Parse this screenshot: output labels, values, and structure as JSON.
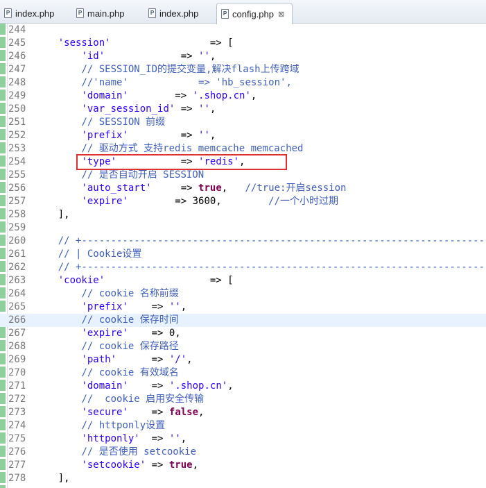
{
  "tabs": [
    {
      "label": "index.php",
      "active": false,
      "icon": "php-file-icon"
    },
    {
      "label": "main.php",
      "active": false,
      "icon": "php-file-icon"
    },
    {
      "label": "index.php",
      "active": false,
      "icon": "php-file-icon"
    },
    {
      "label": "config.php",
      "active": true,
      "icon": "php-file-icon",
      "close": "⊠"
    }
  ],
  "current_line": 266,
  "highlighted_line": 254,
  "colors": {
    "string": "#2a00ff",
    "keyword": "#7f0055",
    "comment": "#3f5fbf",
    "highlight_box": "#e03030"
  },
  "lines": [
    {
      "n": "244",
      "indent": "",
      "parts": []
    },
    {
      "n": "245",
      "indent": "    ",
      "parts": [
        [
          "str",
          "'session'"
        ],
        [
          "op",
          "                 => ["
        ]
      ]
    },
    {
      "n": "246",
      "indent": "        ",
      "parts": [
        [
          "str",
          "'id'"
        ],
        [
          "op",
          "             => "
        ],
        [
          "str",
          "''"
        ],
        [
          "op",
          ","
        ]
      ]
    },
    {
      "n": "247",
      "indent": "        ",
      "parts": [
        [
          "com",
          "// SESSION_ID的提交变量,解决flash上传跨域"
        ]
      ]
    },
    {
      "n": "248",
      "indent": "        ",
      "parts": [
        [
          "com",
          "//'name'            => 'hb_session',"
        ]
      ]
    },
    {
      "n": "249",
      "indent": "        ",
      "parts": [
        [
          "str",
          "'domain'"
        ],
        [
          "op",
          "        => "
        ],
        [
          "str",
          "'.shop.cn'"
        ],
        [
          "op",
          ","
        ]
      ]
    },
    {
      "n": "250",
      "indent": "        ",
      "parts": [
        [
          "str",
          "'var_session_id'"
        ],
        [
          "op",
          " => "
        ],
        [
          "str",
          "''"
        ],
        [
          "op",
          ","
        ]
      ]
    },
    {
      "n": "251",
      "indent": "        ",
      "parts": [
        [
          "com",
          "// SESSION 前缀"
        ]
      ]
    },
    {
      "n": "252",
      "indent": "        ",
      "parts": [
        [
          "str",
          "'prefix'"
        ],
        [
          "op",
          "         => "
        ],
        [
          "str",
          "''"
        ],
        [
          "op",
          ","
        ]
      ]
    },
    {
      "n": "253",
      "indent": "        ",
      "parts": [
        [
          "com",
          "// 驱动方式 支持redis memcache memcached"
        ]
      ]
    },
    {
      "n": "254",
      "indent": "        ",
      "parts": [
        [
          "str",
          "'type'"
        ],
        [
          "op",
          "           => "
        ],
        [
          "str",
          "'redis'"
        ],
        [
          "op",
          ","
        ]
      ]
    },
    {
      "n": "255",
      "indent": "        ",
      "parts": [
        [
          "com",
          "// 是否自动开启 SESSION"
        ]
      ]
    },
    {
      "n": "256",
      "indent": "        ",
      "parts": [
        [
          "str",
          "'auto_start'"
        ],
        [
          "op",
          "     => "
        ],
        [
          "kw",
          "true"
        ],
        [
          "op",
          ",   "
        ],
        [
          "com",
          "//true:开启session"
        ]
      ]
    },
    {
      "n": "257",
      "indent": "        ",
      "parts": [
        [
          "str",
          "'expire'"
        ],
        [
          "op",
          "        => 3600,        "
        ],
        [
          "com",
          "//一个小时过期"
        ]
      ]
    },
    {
      "n": "258",
      "indent": "    ",
      "parts": [
        [
          "op",
          "],"
        ]
      ]
    },
    {
      "n": "259",
      "indent": "",
      "parts": []
    },
    {
      "n": "260",
      "indent": "    ",
      "parts": [
        [
          "com",
          "// +----------------------------------------------------------------------"
        ]
      ]
    },
    {
      "n": "261",
      "indent": "    ",
      "parts": [
        [
          "com",
          "// | Cookie设置"
        ]
      ]
    },
    {
      "n": "262",
      "indent": "    ",
      "parts": [
        [
          "com",
          "// +----------------------------------------------------------------------"
        ]
      ]
    },
    {
      "n": "263",
      "indent": "    ",
      "parts": [
        [
          "str",
          "'cookie'"
        ],
        [
          "op",
          "                  => ["
        ]
      ]
    },
    {
      "n": "264",
      "indent": "        ",
      "parts": [
        [
          "com",
          "// cookie 名称前缀"
        ]
      ]
    },
    {
      "n": "265",
      "indent": "        ",
      "parts": [
        [
          "str",
          "'prefix'"
        ],
        [
          "op",
          "    => "
        ],
        [
          "str",
          "''"
        ],
        [
          "op",
          ","
        ]
      ]
    },
    {
      "n": "266",
      "indent": "        ",
      "parts": [
        [
          "com",
          "// cookie 保存时间"
        ]
      ]
    },
    {
      "n": "267",
      "indent": "        ",
      "parts": [
        [
          "str",
          "'expire'"
        ],
        [
          "op",
          "    => 0,"
        ]
      ]
    },
    {
      "n": "268",
      "indent": "        ",
      "parts": [
        [
          "com",
          "// cookie 保存路径"
        ]
      ]
    },
    {
      "n": "269",
      "indent": "        ",
      "parts": [
        [
          "str",
          "'path'"
        ],
        [
          "op",
          "      => "
        ],
        [
          "str",
          "'/'"
        ],
        [
          "op",
          ","
        ]
      ]
    },
    {
      "n": "270",
      "indent": "        ",
      "parts": [
        [
          "com",
          "// cookie 有效域名"
        ]
      ]
    },
    {
      "n": "271",
      "indent": "        ",
      "parts": [
        [
          "str",
          "'domain'"
        ],
        [
          "op",
          "    => "
        ],
        [
          "str",
          "'.shop.cn'"
        ],
        [
          "op",
          ","
        ]
      ]
    },
    {
      "n": "272",
      "indent": "        ",
      "parts": [
        [
          "com",
          "//  cookie 启用安全传输"
        ]
      ]
    },
    {
      "n": "273",
      "indent": "        ",
      "parts": [
        [
          "str",
          "'secure'"
        ],
        [
          "op",
          "    => "
        ],
        [
          "kw",
          "false"
        ],
        [
          "op",
          ","
        ]
      ]
    },
    {
      "n": "274",
      "indent": "        ",
      "parts": [
        [
          "com",
          "// httponly设置"
        ]
      ]
    },
    {
      "n": "275",
      "indent": "        ",
      "parts": [
        [
          "str",
          "'httponly'"
        ],
        [
          "op",
          "  => "
        ],
        [
          "str",
          "''"
        ],
        [
          "op",
          ","
        ]
      ]
    },
    {
      "n": "276",
      "indent": "        ",
      "parts": [
        [
          "com",
          "// 是否使用 setcookie"
        ]
      ]
    },
    {
      "n": "277",
      "indent": "        ",
      "parts": [
        [
          "str",
          "'setcookie'"
        ],
        [
          "op",
          " => "
        ],
        [
          "kw",
          "true"
        ],
        [
          "op",
          ","
        ]
      ]
    },
    {
      "n": "278",
      "indent": "    ",
      "parts": [
        [
          "op",
          "],"
        ]
      ]
    }
  ]
}
